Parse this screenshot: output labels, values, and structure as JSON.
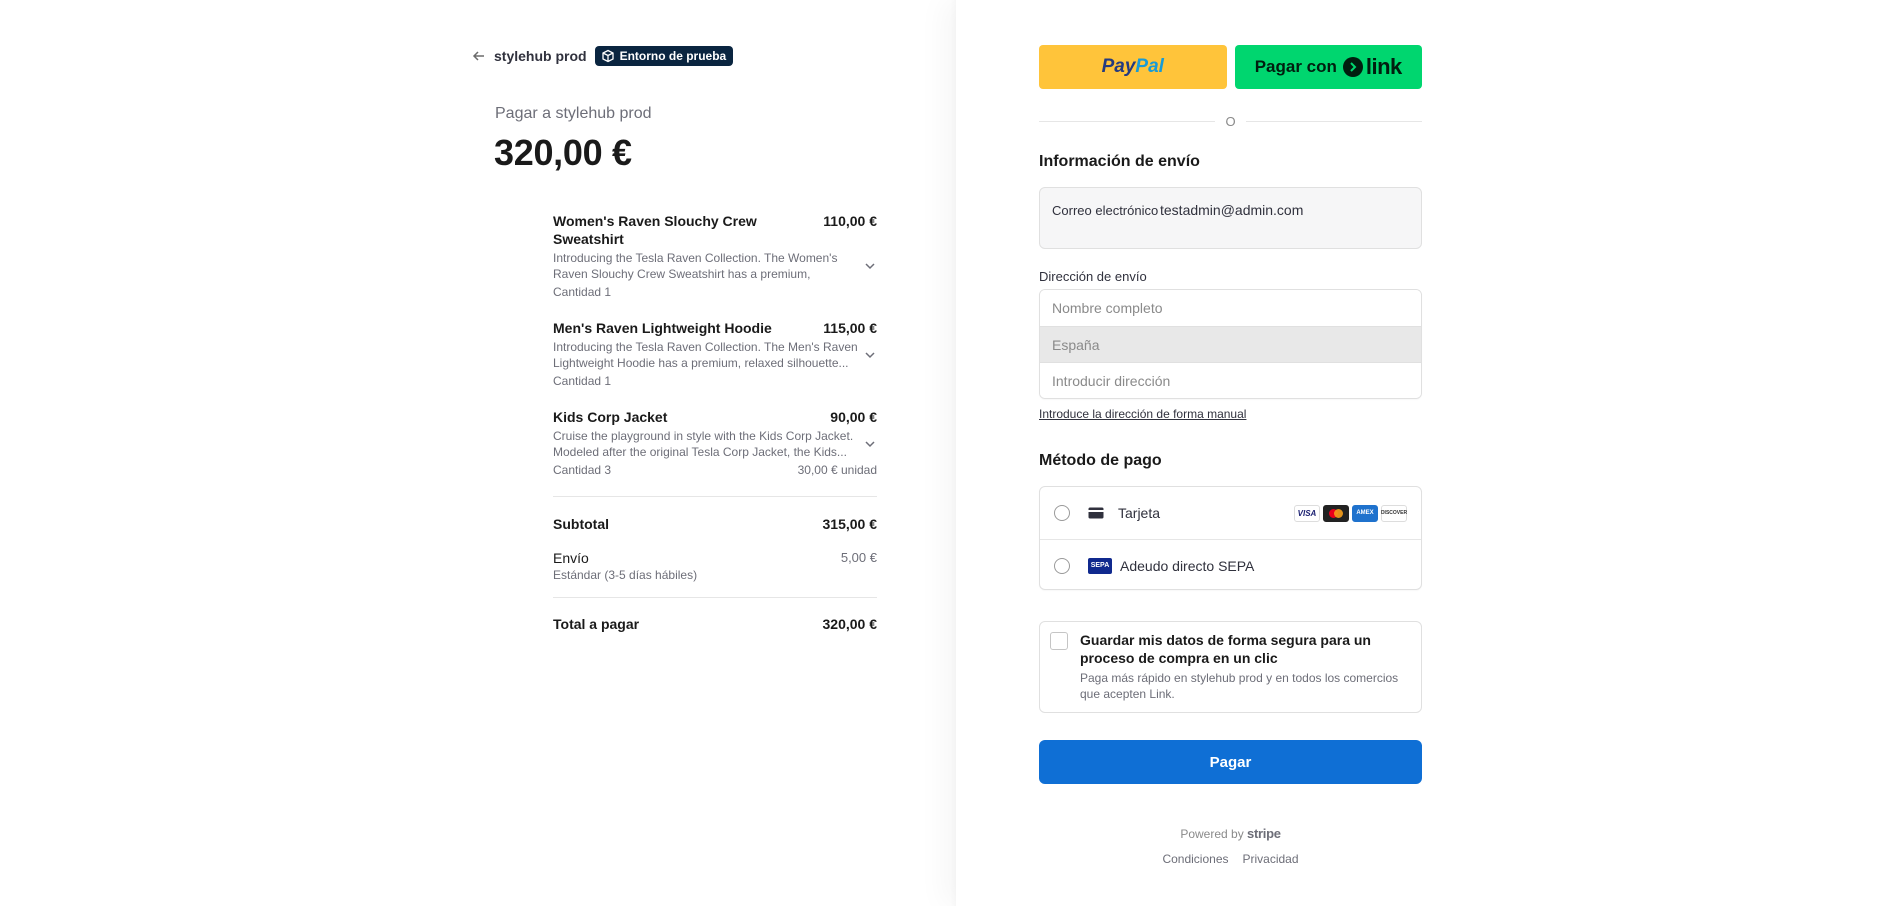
{
  "header": {
    "merchant_name": "stylehub prod",
    "test_badge": "Entorno de prueba"
  },
  "summary": {
    "pay_to": "Pagar a stylehub prod",
    "total_big": "320,00 €",
    "items": [
      {
        "name": "Women's Raven Slouchy Crew Sweatshirt",
        "price": "110,00 €",
        "description": "Introducing the Tesla Raven Collection. The Women's Raven Slouchy Crew Sweatshirt has a premium, relaxed...",
        "quantity": "Cantidad 1",
        "unit_price": ""
      },
      {
        "name": "Men's Raven Lightweight Hoodie",
        "price": "115,00 €",
        "description": "Introducing the Tesla Raven Collection. The Men's Raven Lightweight Hoodie has a premium, relaxed silhouette...",
        "quantity": "Cantidad 1",
        "unit_price": ""
      },
      {
        "name": "Kids Corp Jacket",
        "price": "90,00 €",
        "description": "Cruise the playground in style with the Kids Corp Jacket. Modeled after the original Tesla Corp Jacket, the Kids...",
        "quantity": "Cantidad 3",
        "unit_price": "30,00 € unidad"
      }
    ],
    "subtotal_label": "Subtotal",
    "subtotal_value": "315,00 €",
    "shipping_label": "Envío",
    "shipping_sub": "Estándar (3-5 días hábiles)",
    "shipping_value": "5,00 €",
    "total_label": "Total a pagar",
    "total_value": "320,00 €"
  },
  "wallets": {
    "paypal_pay": "Pay",
    "paypal_pal": "Pal",
    "link_label": "Pagar con",
    "link_word": "link"
  },
  "or_text": "O",
  "shipping_info": {
    "title": "Información de envío",
    "email_label": "Correo electrónico",
    "email_value": "testadmin@admin.com",
    "address_label": "Dirección de envío",
    "name_placeholder": "Nombre completo",
    "country": "España",
    "address_placeholder": "Introducir dirección",
    "manual_link": "Introduce la dirección de forma manual"
  },
  "payment": {
    "title": "Método de pago",
    "methods": [
      {
        "label": "Tarjeta"
      },
      {
        "label": "Adeudo directo SEPA"
      }
    ],
    "brands": {
      "visa": "VISA",
      "amex": "AMEX",
      "discover": "DISCOVER"
    },
    "sepa_icon_text": "SEPA"
  },
  "save": {
    "title": "Guardar mis datos de forma segura para un proceso de compra en un clic",
    "subtitle": "Paga más rápido en stylehub prod y en todos los comercios que acepten Link."
  },
  "pay_button": "Pagar",
  "footer": {
    "powered_by": "Powered by",
    "stripe": "stripe",
    "terms": "Condiciones",
    "privacy": "Privacidad"
  },
  "colors": {
    "pay_button": "#0f6fd5",
    "paypal": "#ffc43a",
    "link": "#00d66f",
    "test_badge": "#0a2540"
  }
}
